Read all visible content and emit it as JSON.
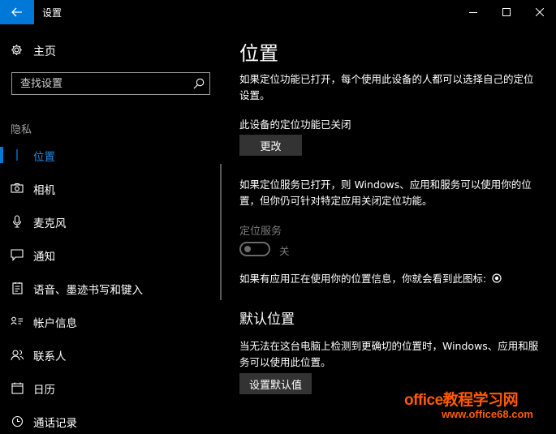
{
  "window": {
    "title": "设置",
    "back_icon": "arrow-left-icon",
    "controls": [
      "minimize-icon",
      "maximize-icon",
      "close-icon"
    ],
    "accent_color": "#0078d7"
  },
  "sidebar": {
    "home": {
      "label": "主页",
      "icon": "gear-icon"
    },
    "search": {
      "placeholder": "查找设置",
      "icon": "search-icon"
    },
    "section_heading": "隐私",
    "items": [
      {
        "label": "位置",
        "icon": "location-icon",
        "active": true
      },
      {
        "label": "相机",
        "icon": "camera-icon",
        "active": false
      },
      {
        "label": "麦克风",
        "icon": "microphone-icon",
        "active": false
      },
      {
        "label": "通知",
        "icon": "notification-icon",
        "active": false
      },
      {
        "label": "语音、墨迹书写和键入",
        "icon": "speech-icon",
        "active": false
      },
      {
        "label": "帐户信息",
        "icon": "account-info-icon",
        "active": false
      },
      {
        "label": "联系人",
        "icon": "contacts-icon",
        "active": false
      },
      {
        "label": "日历",
        "icon": "calendar-icon",
        "active": false
      },
      {
        "label": "通话记录",
        "icon": "call-history-icon",
        "active": false
      }
    ]
  },
  "content": {
    "title": "位置",
    "intro": "如果定位功能已打开，每个使用此设备的人都可以选择自己的定位设置。",
    "device_status": "此设备的定位功能已关闭",
    "change_button": "更改",
    "service_description": "如果定位服务已打开，则 Windows、应用和服务可以使用你的位置，但你仍可针对特定应用关闭定位功能。",
    "service_toggle": {
      "label": "定位服务",
      "state": "关",
      "on": false
    },
    "indicator_text": "如果有应用正在使用你的位置信息，你就会看到此图标:",
    "indicator_icon": "location-in-use-icon",
    "default_location_heading": "默认位置",
    "default_location_description": "当无法在这台电脑上检测到更确切的位置时，Windows、应用和服务可以使用此位置。",
    "set_default_button": "设置默认值"
  },
  "watermark": {
    "line1": "office教程学习网",
    "line2": "www.office68.com",
    "color": "#ff5a00"
  }
}
